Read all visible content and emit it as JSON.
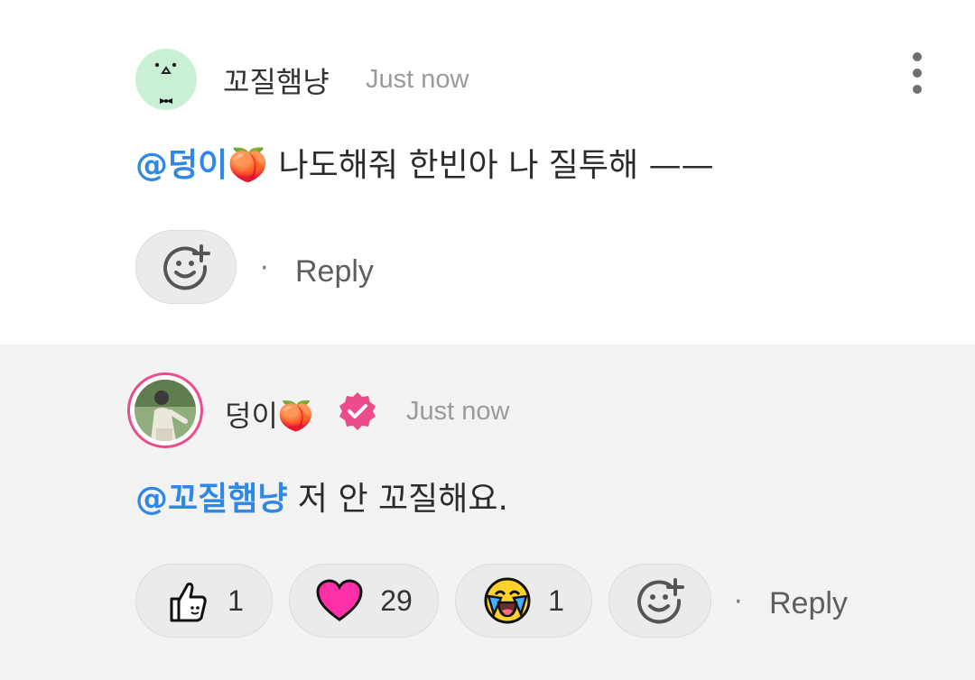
{
  "comments": [
    {
      "author": "꼬질햄냥",
      "time": "Just now",
      "mention": "@덩이🍑",
      "text": " 나도해줘 한빈아 나 질투해 ——",
      "reply_label": "Reply"
    },
    {
      "author": "덩이🍑",
      "verified": true,
      "time": "Just now",
      "mention": "@꼬질햄냥",
      "text": " 저 안 꼬질해요.",
      "reactions": [
        {
          "icon": "thumbs-up-icon",
          "count": "1"
        },
        {
          "icon": "heart-icon",
          "count": "29"
        },
        {
          "icon": "crying-laughing-face-icon",
          "count": "1"
        }
      ],
      "reply_label": "Reply"
    }
  ],
  "colors": {
    "mention": "#2f87e6",
    "heart": "#ff2fa8",
    "verified_badge": "#ec4c8a",
    "avatar_ring": "#ec4c8a"
  }
}
